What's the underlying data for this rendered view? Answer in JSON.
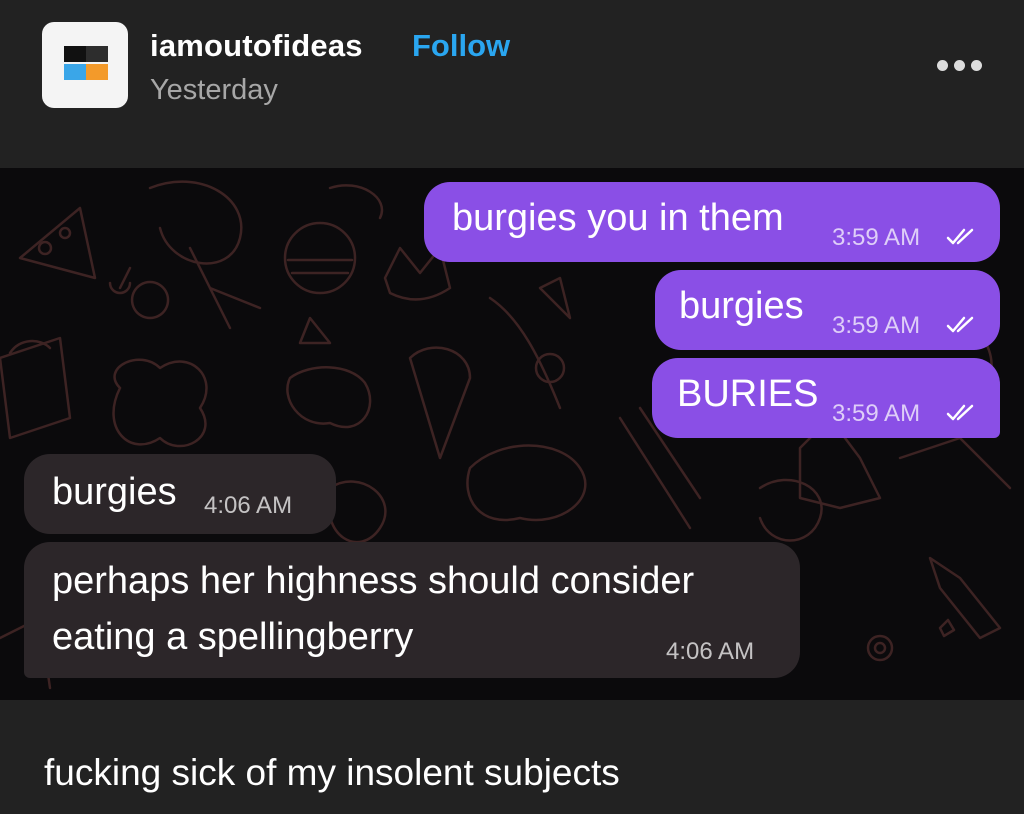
{
  "post": {
    "username": "iamoutofideas",
    "follow_label": "Follow",
    "timestamp": "Yesterday",
    "more_icon": "ellipsis-icon",
    "caption": "fucking sick of my insolent subjects"
  },
  "chat": {
    "messages": [
      {
        "direction": "outgoing",
        "text": "burgies you in them",
        "time": "3:59 AM",
        "status": "read"
      },
      {
        "direction": "outgoing",
        "text": "burgies",
        "time": "3:59 AM",
        "status": "read"
      },
      {
        "direction": "outgoing",
        "text": "BURIES",
        "time": "3:59 AM",
        "status": "read"
      },
      {
        "direction": "incoming",
        "text": "burgies",
        "time": "4:06 AM"
      },
      {
        "direction": "incoming",
        "text_line1": "perhaps her highness should consider",
        "text_line2": "eating a spellingberry",
        "time": "4:06 AM"
      }
    ]
  },
  "colors": {
    "background": "#222222",
    "chat_background": "#0b0a0c",
    "outgoing_bubble": "#8a4fe6",
    "incoming_bubble": "#2c2629",
    "follow": "#2aa6f0"
  }
}
